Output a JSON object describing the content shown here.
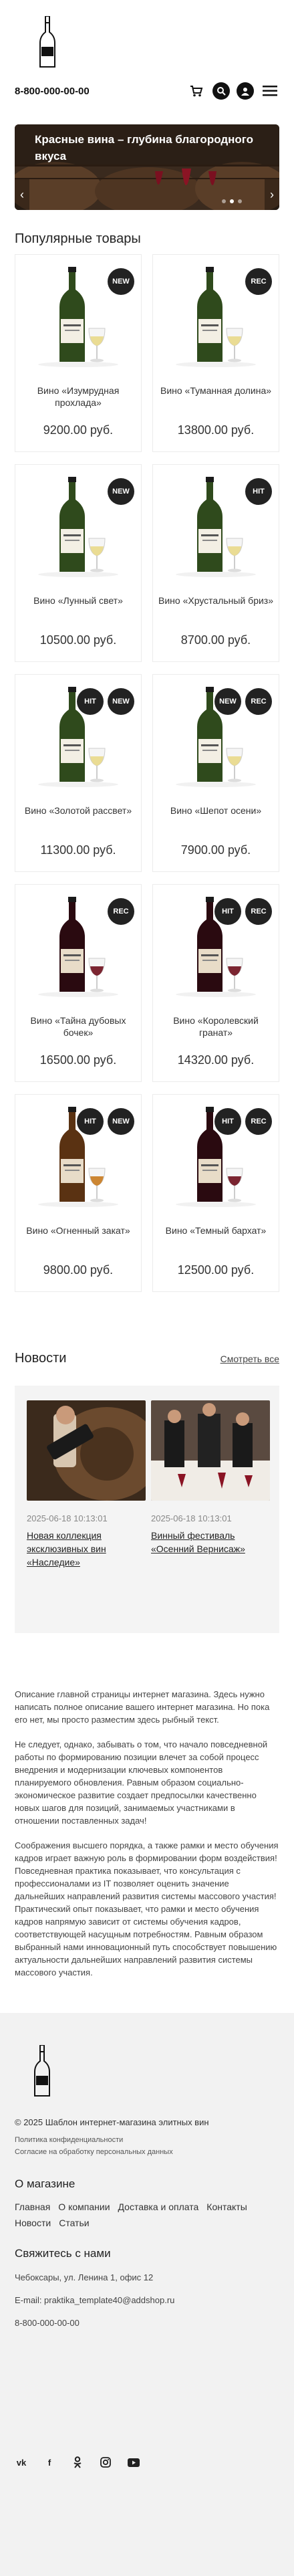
{
  "header": {
    "phone": "8-800-000-00-00",
    "icons": [
      "cart-icon",
      "search-icon",
      "user-icon",
      "menu-icon"
    ]
  },
  "banner": {
    "title": "Красные вина – глубина благородного вкуса",
    "slides": 3,
    "active_slide": 1
  },
  "products": {
    "title": "Популярные товары",
    "items": [
      {
        "name": "Вино «Изумрудная прохлада»",
        "price": "9200.00 руб.",
        "badges": [
          "NEW"
        ],
        "wine": "white"
      },
      {
        "name": "Вино «Туманная долина»",
        "price": "13800.00 руб.",
        "badges": [
          "REC"
        ],
        "wine": "white"
      },
      {
        "name": "Вино «Лунный свет»",
        "price": "10500.00 руб.",
        "badges": [
          "NEW"
        ],
        "wine": "white"
      },
      {
        "name": "Вино «Хрустальный бриз»",
        "price": "8700.00 руб.",
        "badges": [
          "HIT"
        ],
        "wine": "white"
      },
      {
        "name": "Вино «Золотой рассвет»",
        "price": "11300.00 руб.",
        "badges": [
          "HIT",
          "NEW"
        ],
        "wine": "white"
      },
      {
        "name": "Вино «Шепот осени»",
        "price": "7900.00 руб.",
        "badges": [
          "NEW",
          "REC"
        ],
        "wine": "white"
      },
      {
        "name": "Вино «Тайна дубовых бочек»",
        "price": "16500.00 руб.",
        "badges": [
          "REC"
        ],
        "wine": "red"
      },
      {
        "name": "Вино «Королевский гранат»",
        "price": "14320.00 руб.",
        "badges": [
          "HIT",
          "REC"
        ],
        "wine": "red"
      },
      {
        "name": "Вино «Огненный закат»",
        "price": "9800.00 руб.",
        "badges": [
          "HIT",
          "NEW"
        ],
        "wine": "amber"
      },
      {
        "name": "Вино «Темный бархат»",
        "price": "12500.00 руб.",
        "badges": [
          "HIT",
          "REC"
        ],
        "wine": "red"
      }
    ]
  },
  "news": {
    "title": "Новости",
    "all_label": "Смотреть все",
    "items": [
      {
        "date": "2025-06-18 10:13:01",
        "name": "Новая коллекция эксклюзивных вин «Наследие»"
      },
      {
        "date": "2025-06-18 10:13:01",
        "name": "Винный фестиваль «Осенний Вернисаж»"
      }
    ]
  },
  "description": {
    "p1": "Описание главной страницы интернет магазина. Здесь нужно написать полное описание вашего интернет магазина. Но пока его нет, мы просто разместим здесь рыбный текст.",
    "p2": "Не следует, однако, забывать о том, что начало повседневной работы по формированию позиции влечет за собой процесс внедрения и модернизации ключевых компонентов планируемого обновления. Равным образом социально-экономическое развитие создает предпосылки качественно новых шагов для позиций, занимаемых участниками в отношении поставленных задач!",
    "p3": "Соображения высшего порядка, а также рамки и место обучения кадров играет важную роль в формировании форм воздействия! Повседневная практика показывает, что консультация с профессионалами из IT позволяет оценить значение дальнейших направлений развития системы массового участия! Практический опыт показывает, что рамки и место обучения кадров напрямую зависит от системы обучения кадров, соответствующей насущным потребностям. Равным образом выбранный нами инновационный путь способствует повышению актуальности дальнейших направлений развития системы массового участия."
  },
  "footer": {
    "copyright": "© 2025 Шаблон интернет-магазина элитных вин",
    "privacy": "Политика конфиденциальности",
    "consent": "Согласие на обработку персональных данных",
    "about_title": "О магазине",
    "links": [
      "Главная",
      "О компании",
      "Доставка и оплата",
      "Контакты",
      "Новости",
      "Статьи"
    ],
    "contact_title": "Свяжитесь с нами",
    "address": "Чебоксары, ул. Ленина 1, офис 12",
    "email": "E-mail: praktika_template40@addshop.ru",
    "phone": "8-800-000-00-00",
    "social": [
      "vk-icon",
      "facebook-icon",
      "odnoklassniki-icon",
      "instagram-icon",
      "youtube-icon"
    ]
  }
}
